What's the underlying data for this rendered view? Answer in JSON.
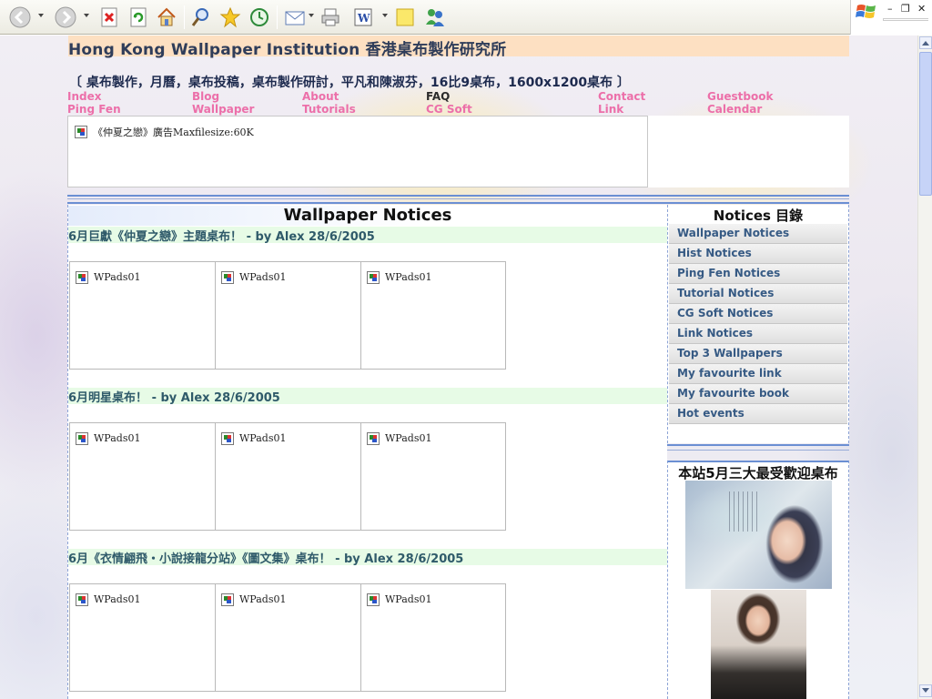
{
  "browser": {
    "toolbar_buttons": [
      "back-icon",
      "forward-icon",
      "stop-icon",
      "refresh-icon",
      "home-icon",
      "search-icon",
      "favorites-icon",
      "history-icon",
      "mail-icon",
      "print-icon",
      "edit-icon",
      "notes-icon",
      "messenger-icon"
    ],
    "window_controls": [
      "–",
      "❐",
      "✕"
    ]
  },
  "header": {
    "title": "Hong Kong Wallpaper Institution 香港桌布製作研究所",
    "tagline": "〔 桌布製作，月曆，桌布投稿，桌布製作研討，平凡和陳淑芬，16比9桌布，1600x1200桌布 〕",
    "nav": [
      {
        "label": "Index"
      },
      {
        "label": "Blog"
      },
      {
        "label": "About"
      },
      {
        "label": "FAQ"
      },
      {
        "label": "Contact"
      },
      {
        "label": "Guestbook"
      },
      {
        "label": "Ping Fen"
      },
      {
        "label": "Wallpaper"
      },
      {
        "label": "Tutorials"
      },
      {
        "label": "CG Soft"
      },
      {
        "label": "Link"
      },
      {
        "label": "Calendar"
      }
    ],
    "ad_alt": "《仲夏之戀》廣告Maxfilesize:60K"
  },
  "main": {
    "title": "Wallpaper Notices",
    "posts": [
      {
        "title": "6月巨獻《仲夏之戀》主題桌布！ - by Alex 28/6/2005",
        "images": [
          "WPads01",
          "WPads01",
          "WPads01"
        ]
      },
      {
        "title": "6月明星桌布！ - by Alex 28/6/2005",
        "images": [
          "WPads01",
          "WPads01",
          "WPads01"
        ]
      },
      {
        "title": "6月《衣情翩飛・小說接龍分站》《圖文集》桌布！ - by Alex 28/6/2005",
        "images": [
          "WPads01",
          "WPads01",
          "WPads01"
        ]
      }
    ]
  },
  "sidebar": {
    "title": "Notices 目錄",
    "items": [
      {
        "label": "Wallpaper Notices"
      },
      {
        "label": "Hist Notices"
      },
      {
        "label": "Ping Fen Notices"
      },
      {
        "label": "Tutorial Notices"
      },
      {
        "label": "CG Soft Notices"
      },
      {
        "label": "Link Notices"
      },
      {
        "label": "Top 3 Wallpapers"
      },
      {
        "label": "My favourite link"
      },
      {
        "label": "My favourite book"
      },
      {
        "label": "Hot events"
      }
    ],
    "popular_title": "本站5月三大最受歡迎桌布"
  },
  "colors": {
    "nav_link": "#ec6fa9",
    "title_bar": "#fde0c2",
    "post_head_bg": "#e7fbe6",
    "sidebar_link": "#365a84",
    "rule_blue": "#6b8fd3"
  }
}
